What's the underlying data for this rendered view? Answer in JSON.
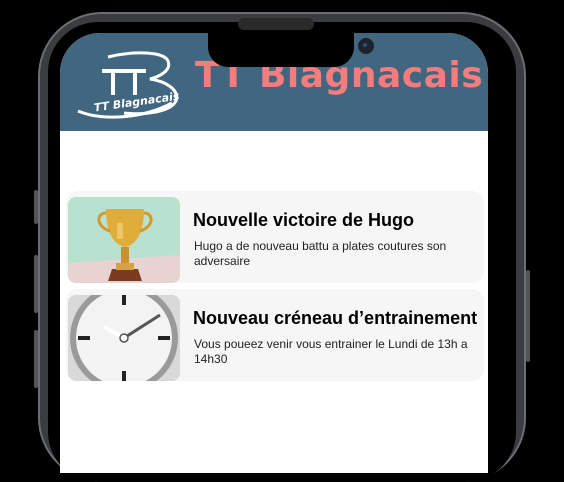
{
  "app": {
    "title": "TT Blagnacais",
    "logo_text": "TT Blagnacais"
  },
  "colors": {
    "header_bg": "#41667f",
    "title_color": "#f47c7c",
    "card_bg": "#f6f6f6"
  },
  "news": [
    {
      "title": "Nouvelle victoire de Hugo",
      "description": "Hugo a de nouveau battu a plates coutures son adversaire",
      "icon": "trophy-icon"
    },
    {
      "title": "Nouveau créneau d’entrainement",
      "description": "Vous poueez venir vous entrainer le Lundi de 13h a 14h30",
      "icon": "clock-icon"
    }
  ]
}
